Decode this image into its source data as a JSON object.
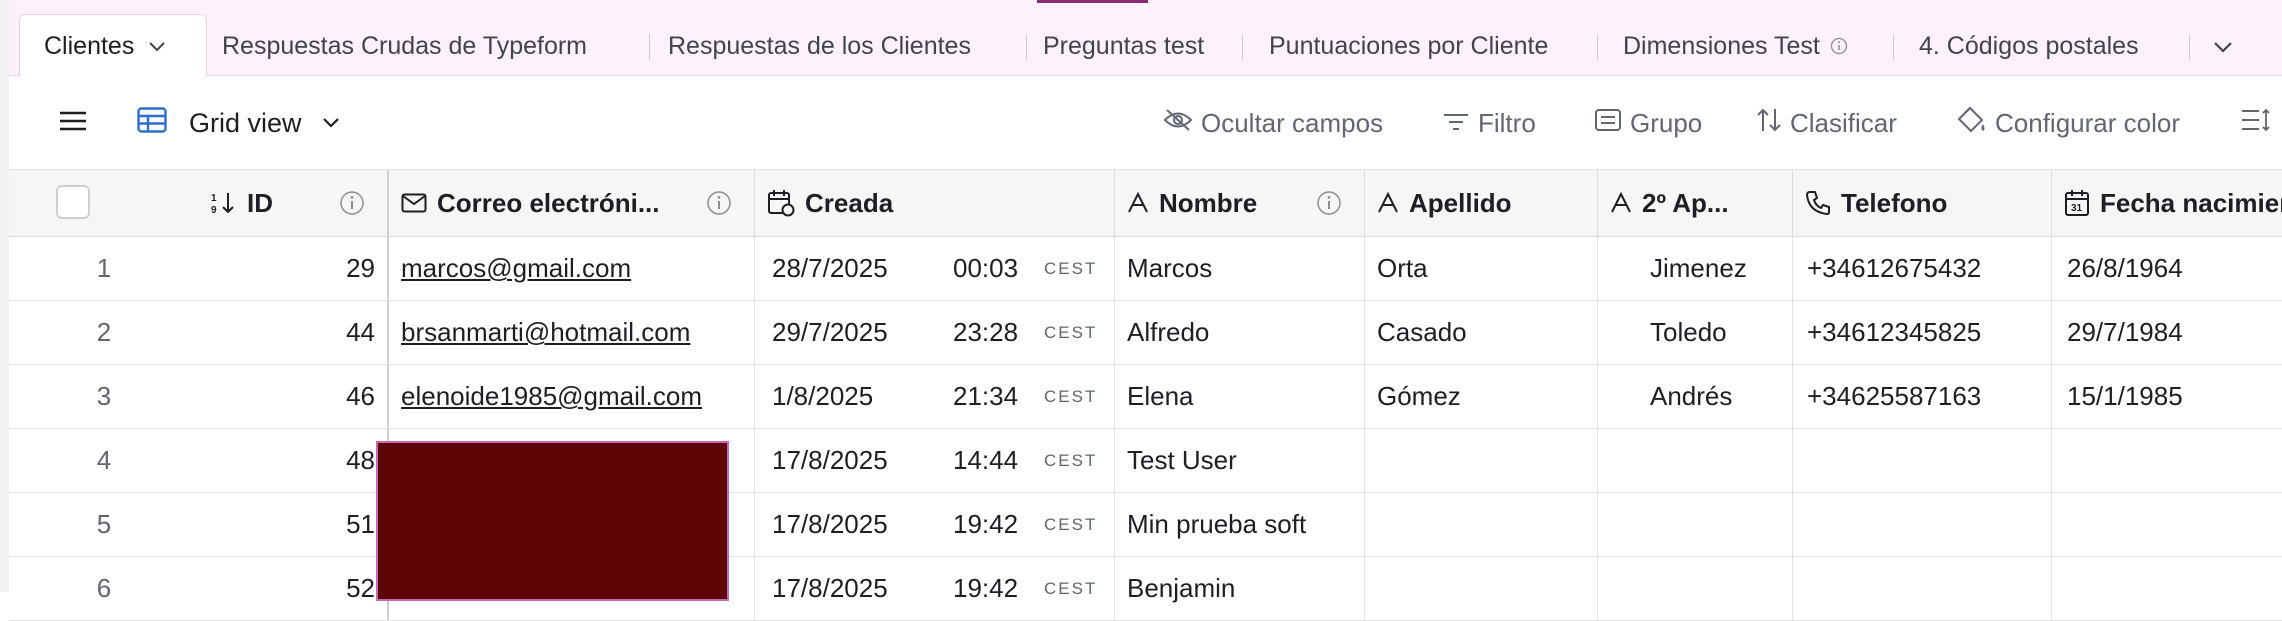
{
  "tabs": {
    "active": "Clientes",
    "items": [
      "Respuestas Crudas de Typeform",
      "Respuestas de los Clientes",
      "Preguntas test",
      "Puntuaciones por Cliente",
      "Dimensiones Test",
      "4. Códigos postales"
    ]
  },
  "toolbar": {
    "view_name": "Grid view",
    "hide_fields": "Ocultar campos",
    "filter": "Filtro",
    "group": "Grupo",
    "sort": "Clasificar",
    "color": "Configurar color"
  },
  "columns": {
    "id": "ID",
    "email": "Correo electróni...",
    "created": "Creada",
    "nombre": "Nombre",
    "apellido": "Apellido",
    "apellido2": "2º Ap...",
    "telefono": "Telefono",
    "fecha": "Fecha nacimien"
  },
  "rows": [
    {
      "n": "1",
      "id": "29",
      "email": "marcos@gmail.com",
      "date": "28/7/2025",
      "time": "00:03",
      "tz": "CEST",
      "nombre": "Marcos",
      "apellido": "Orta",
      "apellido2": "Jimenez",
      "telefono": "+34612675432",
      "fecha": "26/8/1964"
    },
    {
      "n": "2",
      "id": "44",
      "email": "brsanmarti@hotmail.com",
      "date": "29/7/2025",
      "time": "23:28",
      "tz": "CEST",
      "nombre": "Alfredo",
      "apellido": "Casado",
      "apellido2": "Toledo",
      "telefono": "+34612345825",
      "fecha": "29/7/1984"
    },
    {
      "n": "3",
      "id": "46",
      "email": "elenoide1985@gmail.com",
      "date": "1/8/2025",
      "time": "21:34",
      "tz": "CEST",
      "nombre": "Elena",
      "apellido": "Gómez",
      "apellido2": "Andrés",
      "telefono": "+34625587163",
      "fecha": "15/1/1985"
    },
    {
      "n": "4",
      "id": "48",
      "email": "",
      "date": "17/8/2025",
      "time": "14:44",
      "tz": "CEST",
      "nombre": "Test User",
      "apellido": "",
      "apellido2": "",
      "telefono": "",
      "fecha": ""
    },
    {
      "n": "5",
      "id": "51",
      "email": "",
      "date": "17/8/2025",
      "time": "19:42",
      "tz": "CEST",
      "nombre": "Min prueba soft",
      "apellido": "",
      "apellido2": "",
      "telefono": "",
      "fecha": ""
    },
    {
      "n": "6",
      "id": "52",
      "email": "",
      "date": "17/8/2025",
      "time": "19:42",
      "tz": "CEST",
      "nombre": "Benjamin",
      "apellido": "",
      "apellido2": "",
      "telefono": "",
      "fecha": ""
    }
  ],
  "colors": {
    "tab_bar": "#fdf1fb",
    "accent": "#8a2a73",
    "redaction": "#5e0505"
  }
}
